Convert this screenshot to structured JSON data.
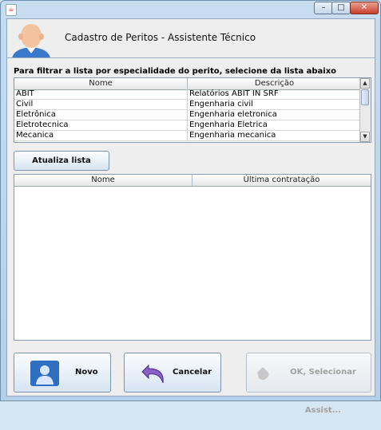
{
  "window": {
    "title_icon": "java-cup-icon",
    "minimize": "–",
    "maximize": "□",
    "close": "✕"
  },
  "header": {
    "title": "Cadastro de Peritos - Assistente Técnico",
    "avatar_icon": "user-avatar-icon"
  },
  "filter": {
    "label": "Para filtrar a lista por especialidade do perito, selecione da lista abaixo",
    "columns": [
      "Nome",
      "Descrição"
    ],
    "rows": [
      {
        "nome": "ABIT",
        "descricao": "Relatórios ABIT IN SRF"
      },
      {
        "nome": "Civil",
        "descricao": "Engenharia civil"
      },
      {
        "nome": "Eletrônica",
        "descricao": "Engenharia eletronica"
      },
      {
        "nome": "Eletrotecnica",
        "descricao": "Engenharia Eletrica"
      },
      {
        "nome": "Mecanica",
        "descricao": "Engenharia mecanica"
      }
    ]
  },
  "refresh_button": "Atualiza lista",
  "experts": {
    "columns": [
      "Nome",
      "Última contratação"
    ]
  },
  "buttons": {
    "novo": "Novo",
    "cancelar": "Cancelar",
    "ok": "OK, Selecionar Assist..."
  },
  "colors": {
    "window_frame": "#b5cfe8",
    "panel": "#eeeeee",
    "disabled_text": "#a0a0a0"
  }
}
